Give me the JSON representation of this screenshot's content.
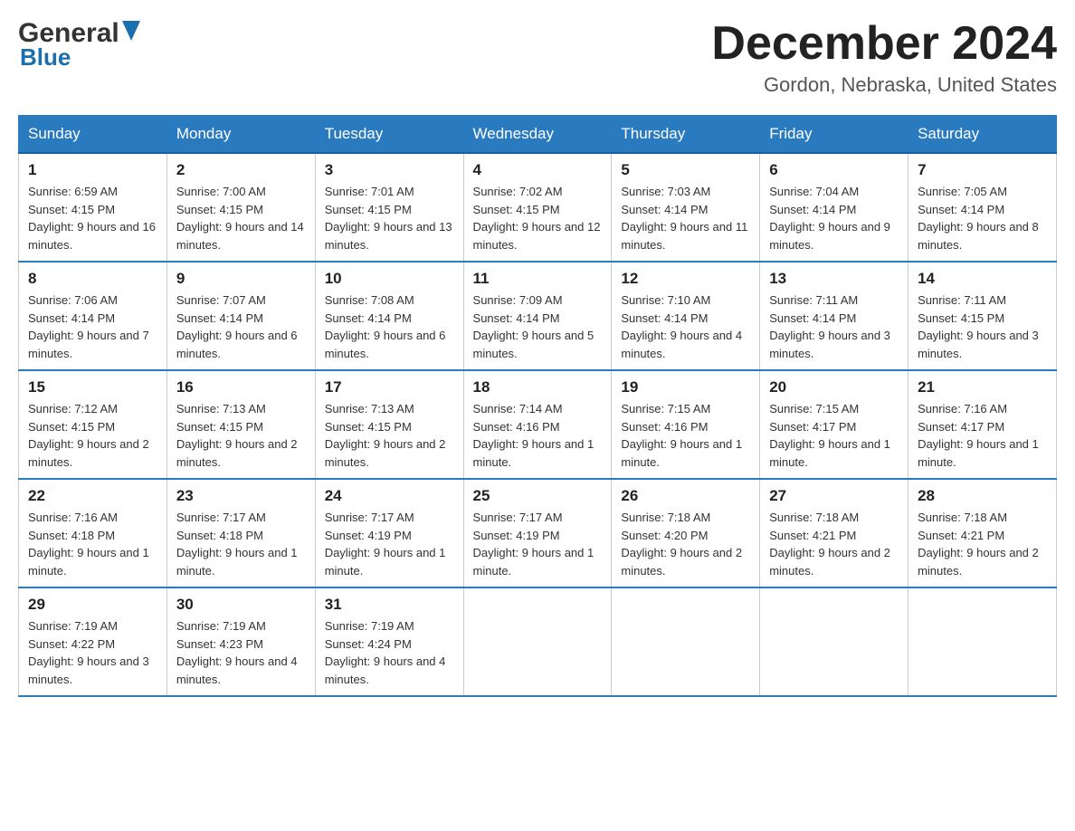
{
  "header": {
    "logo_general": "General",
    "logo_blue": "Blue",
    "month_title": "December 2024",
    "location": "Gordon, Nebraska, United States"
  },
  "days_of_week": [
    "Sunday",
    "Monday",
    "Tuesday",
    "Wednesday",
    "Thursday",
    "Friday",
    "Saturday"
  ],
  "weeks": [
    [
      {
        "day": "1",
        "sunrise": "6:59 AM",
        "sunset": "4:15 PM",
        "daylight": "9 hours and 16 minutes."
      },
      {
        "day": "2",
        "sunrise": "7:00 AM",
        "sunset": "4:15 PM",
        "daylight": "9 hours and 14 minutes."
      },
      {
        "day": "3",
        "sunrise": "7:01 AM",
        "sunset": "4:15 PM",
        "daylight": "9 hours and 13 minutes."
      },
      {
        "day": "4",
        "sunrise": "7:02 AM",
        "sunset": "4:15 PM",
        "daylight": "9 hours and 12 minutes."
      },
      {
        "day": "5",
        "sunrise": "7:03 AM",
        "sunset": "4:14 PM",
        "daylight": "9 hours and 11 minutes."
      },
      {
        "day": "6",
        "sunrise": "7:04 AM",
        "sunset": "4:14 PM",
        "daylight": "9 hours and 9 minutes."
      },
      {
        "day": "7",
        "sunrise": "7:05 AM",
        "sunset": "4:14 PM",
        "daylight": "9 hours and 8 minutes."
      }
    ],
    [
      {
        "day": "8",
        "sunrise": "7:06 AM",
        "sunset": "4:14 PM",
        "daylight": "9 hours and 7 minutes."
      },
      {
        "day": "9",
        "sunrise": "7:07 AM",
        "sunset": "4:14 PM",
        "daylight": "9 hours and 6 minutes."
      },
      {
        "day": "10",
        "sunrise": "7:08 AM",
        "sunset": "4:14 PM",
        "daylight": "9 hours and 6 minutes."
      },
      {
        "day": "11",
        "sunrise": "7:09 AM",
        "sunset": "4:14 PM",
        "daylight": "9 hours and 5 minutes."
      },
      {
        "day": "12",
        "sunrise": "7:10 AM",
        "sunset": "4:14 PM",
        "daylight": "9 hours and 4 minutes."
      },
      {
        "day": "13",
        "sunrise": "7:11 AM",
        "sunset": "4:14 PM",
        "daylight": "9 hours and 3 minutes."
      },
      {
        "day": "14",
        "sunrise": "7:11 AM",
        "sunset": "4:15 PM",
        "daylight": "9 hours and 3 minutes."
      }
    ],
    [
      {
        "day": "15",
        "sunrise": "7:12 AM",
        "sunset": "4:15 PM",
        "daylight": "9 hours and 2 minutes."
      },
      {
        "day": "16",
        "sunrise": "7:13 AM",
        "sunset": "4:15 PM",
        "daylight": "9 hours and 2 minutes."
      },
      {
        "day": "17",
        "sunrise": "7:13 AM",
        "sunset": "4:15 PM",
        "daylight": "9 hours and 2 minutes."
      },
      {
        "day": "18",
        "sunrise": "7:14 AM",
        "sunset": "4:16 PM",
        "daylight": "9 hours and 1 minute."
      },
      {
        "day": "19",
        "sunrise": "7:15 AM",
        "sunset": "4:16 PM",
        "daylight": "9 hours and 1 minute."
      },
      {
        "day": "20",
        "sunrise": "7:15 AM",
        "sunset": "4:17 PM",
        "daylight": "9 hours and 1 minute."
      },
      {
        "day": "21",
        "sunrise": "7:16 AM",
        "sunset": "4:17 PM",
        "daylight": "9 hours and 1 minute."
      }
    ],
    [
      {
        "day": "22",
        "sunrise": "7:16 AM",
        "sunset": "4:18 PM",
        "daylight": "9 hours and 1 minute."
      },
      {
        "day": "23",
        "sunrise": "7:17 AM",
        "sunset": "4:18 PM",
        "daylight": "9 hours and 1 minute."
      },
      {
        "day": "24",
        "sunrise": "7:17 AM",
        "sunset": "4:19 PM",
        "daylight": "9 hours and 1 minute."
      },
      {
        "day": "25",
        "sunrise": "7:17 AM",
        "sunset": "4:19 PM",
        "daylight": "9 hours and 1 minute."
      },
      {
        "day": "26",
        "sunrise": "7:18 AM",
        "sunset": "4:20 PM",
        "daylight": "9 hours and 2 minutes."
      },
      {
        "day": "27",
        "sunrise": "7:18 AM",
        "sunset": "4:21 PM",
        "daylight": "9 hours and 2 minutes."
      },
      {
        "day": "28",
        "sunrise": "7:18 AM",
        "sunset": "4:21 PM",
        "daylight": "9 hours and 2 minutes."
      }
    ],
    [
      {
        "day": "29",
        "sunrise": "7:19 AM",
        "sunset": "4:22 PM",
        "daylight": "9 hours and 3 minutes."
      },
      {
        "day": "30",
        "sunrise": "7:19 AM",
        "sunset": "4:23 PM",
        "daylight": "9 hours and 4 minutes."
      },
      {
        "day": "31",
        "sunrise": "7:19 AM",
        "sunset": "4:24 PM",
        "daylight": "9 hours and 4 minutes."
      },
      null,
      null,
      null,
      null
    ]
  ],
  "labels": {
    "sunrise_prefix": "Sunrise: ",
    "sunset_prefix": "Sunset: ",
    "daylight_prefix": "Daylight: "
  },
  "colors": {
    "header_bg": "#2a7abf",
    "border_accent": "#2a7abf"
  }
}
